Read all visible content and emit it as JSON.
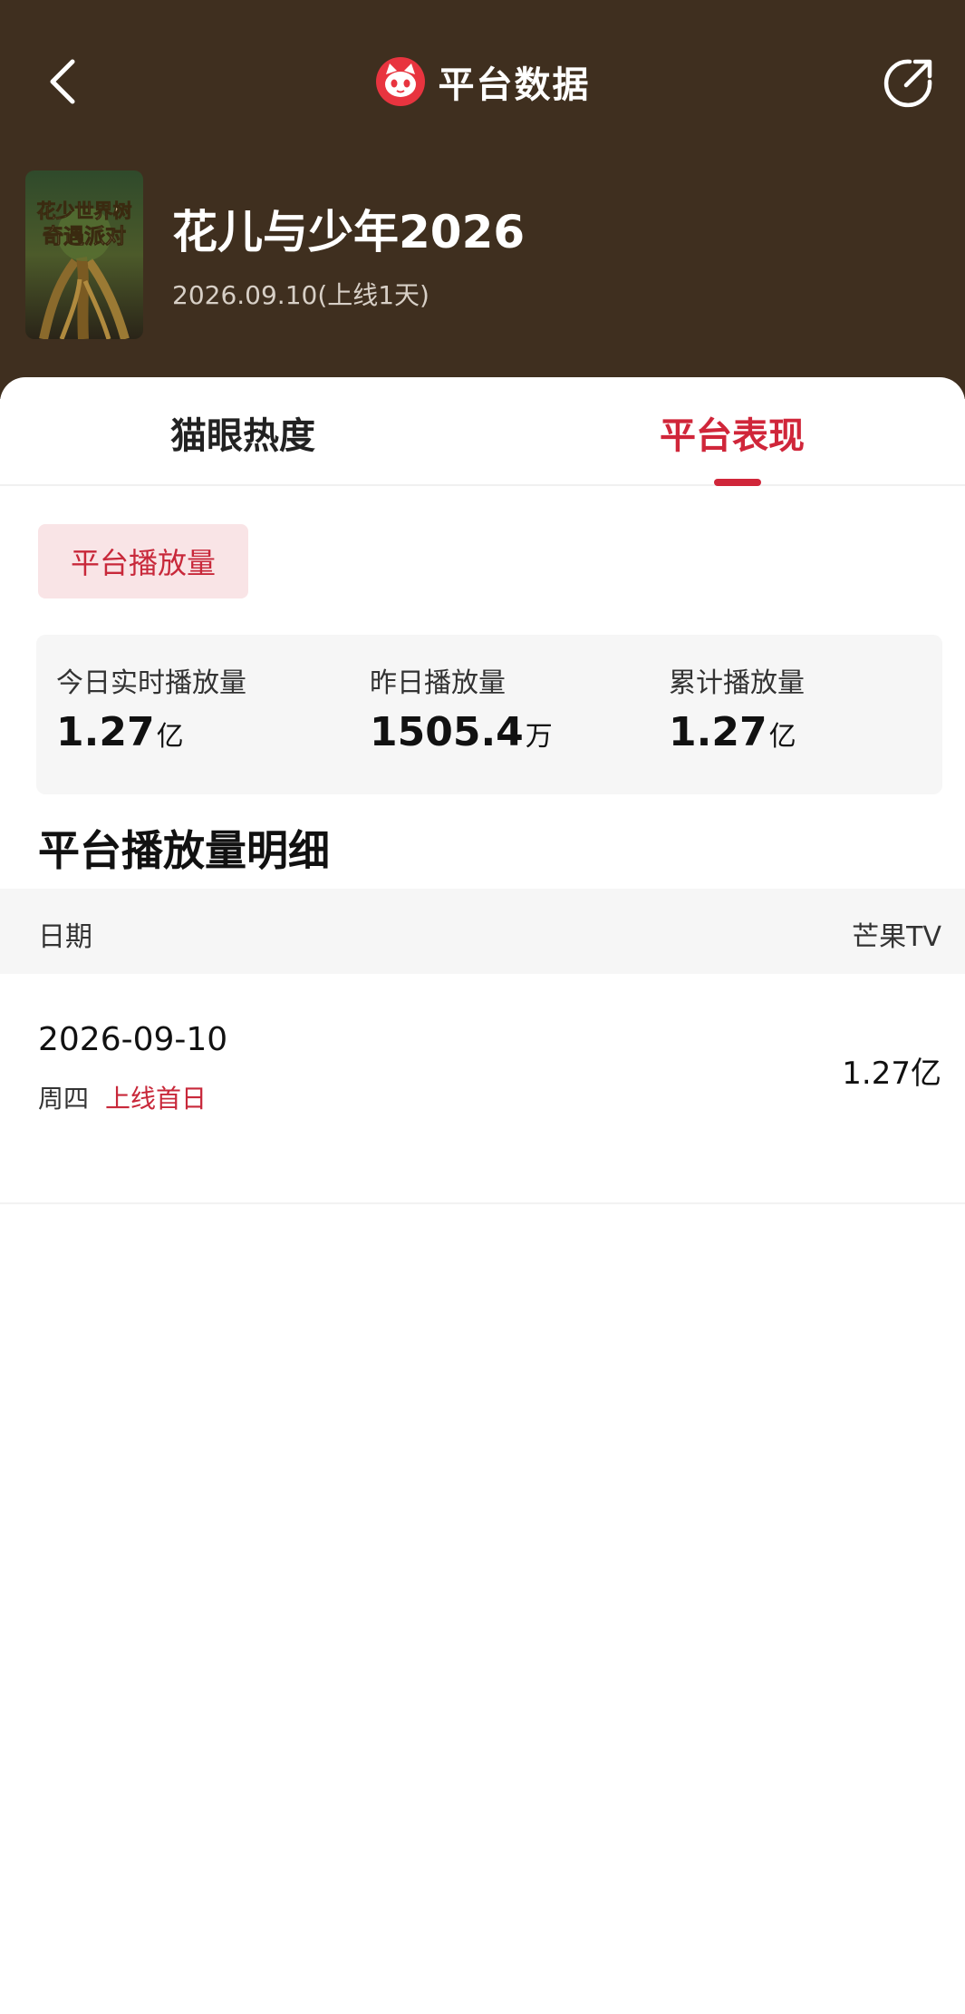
{
  "topbar": {
    "title": "平台数据",
    "back_icon": "chevron-left-icon",
    "share_icon": "share-icon",
    "logo_icon": "maoyan-cat-logo-icon"
  },
  "show": {
    "title": "花儿与少年2026",
    "subtitle": "2026.09.10(上线1天)",
    "poster_text": "花少世界树\n奇遇派对"
  },
  "tabs": [
    {
      "label": "猫眼热度",
      "active": false
    },
    {
      "label": "平台表现",
      "active": true
    }
  ],
  "filter_chip": "平台播放量",
  "stats": [
    {
      "label": "今日实时播放量",
      "value": "1.27",
      "unit": "亿"
    },
    {
      "label": "昨日播放量",
      "value": "1505.4",
      "unit": "万"
    },
    {
      "label": "累计播放量",
      "value": "1.27",
      "unit": "亿"
    }
  ],
  "detail": {
    "title": "平台播放量明细",
    "columns": [
      "日期",
      "芒果TV"
    ],
    "rows": [
      {
        "date": "2026-09-10",
        "weekday": "周四",
        "tag": "上线首日",
        "value": "1.27亿"
      }
    ]
  },
  "colors": {
    "header_bg": "#3f2f1f",
    "accent": "#d0263a",
    "chip_bg": "#f9e4e6",
    "panel_bg": "#f6f6f6"
  }
}
